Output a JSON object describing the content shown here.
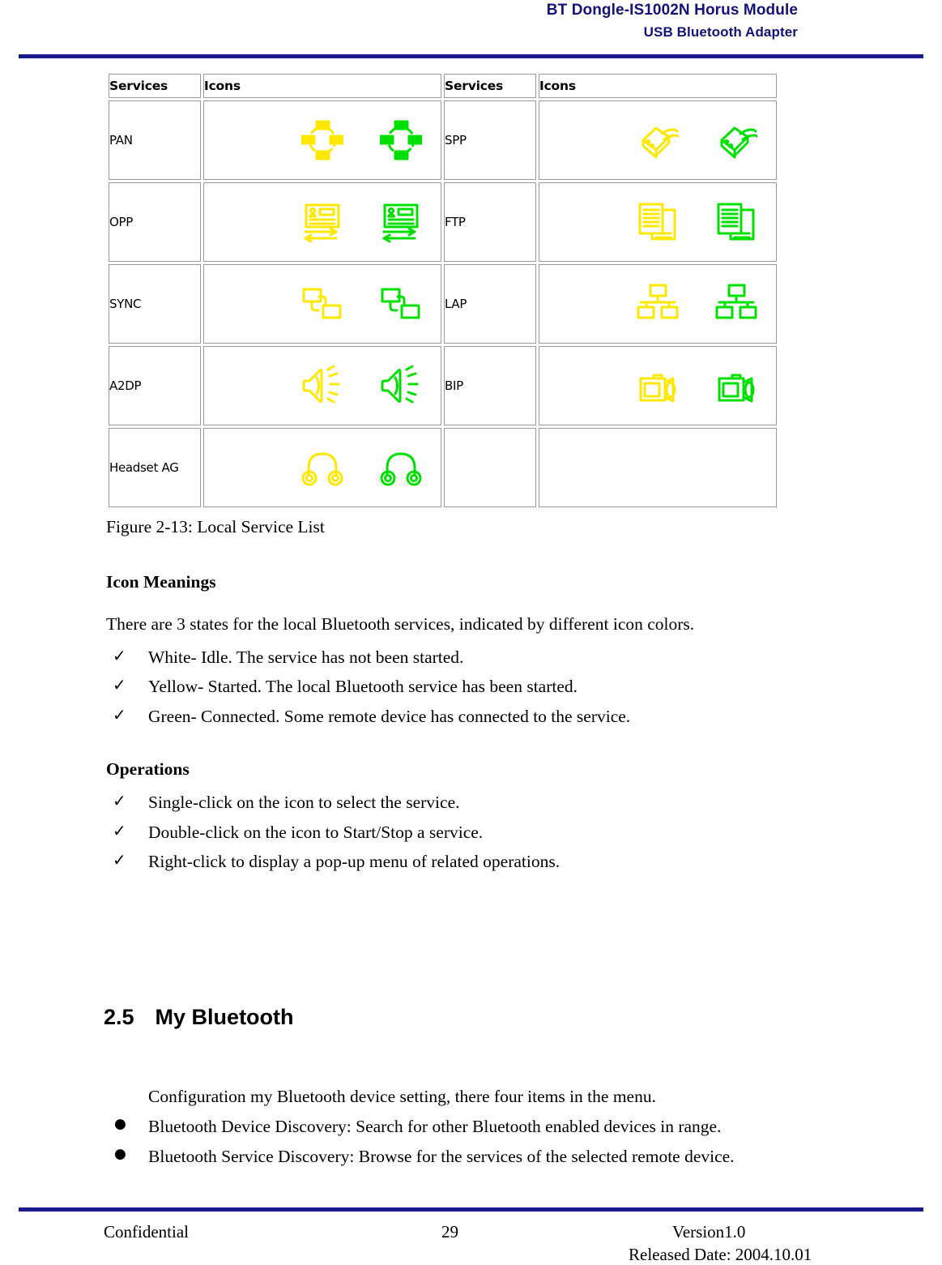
{
  "header": {
    "line1": "BT Dongle-IS1002N Horus Module",
    "line2": "USB Bluetooth Adapter",
    "rule_color": "#1a1a8c"
  },
  "figure": {
    "caption": "Figure 2-13: Local Service List",
    "icon_cell_bg": "#0c7ef5",
    "state_colors": {
      "idle": "#ffffff",
      "started": "#ffe800",
      "connected": "#00e000"
    },
    "columns": [
      {
        "services_header": "Services",
        "icons_header": "Icons"
      },
      {
        "services_header": "Services",
        "icons_header": "Icons"
      }
    ],
    "rows": [
      {
        "left": {
          "service": "PAN",
          "icon": "pan-icon",
          "states": [
            "idle",
            "started",
            "connected"
          ]
        },
        "right": {
          "service": "SPP",
          "icon": "spp-icon",
          "states": [
            "idle",
            "started",
            "connected"
          ]
        }
      },
      {
        "left": {
          "service": "OPP",
          "icon": "opp-icon",
          "states": [
            "idle",
            "started",
            "connected"
          ]
        },
        "right": {
          "service": "FTP",
          "icon": "ftp-icon",
          "states": [
            "idle",
            "started",
            "connected"
          ]
        }
      },
      {
        "left": {
          "service": "SYNC",
          "icon": "sync-icon",
          "states": [
            "idle",
            "started",
            "connected"
          ]
        },
        "right": {
          "service": "LAP",
          "icon": "lap-icon",
          "states": [
            "idle",
            "started",
            "connected"
          ]
        }
      },
      {
        "left": {
          "service": "A2DP",
          "icon": "a2dp-icon",
          "states": [
            "idle",
            "started",
            "connected"
          ]
        },
        "right": {
          "service": "BIP",
          "icon": "bip-icon",
          "states": [
            "idle",
            "started",
            "connected"
          ]
        }
      },
      {
        "left": {
          "service": "Headset AG",
          "icon": "headset-icon",
          "states": [
            "idle",
            "started",
            "connected"
          ]
        },
        "right": {
          "service": "",
          "icon": "",
          "states": []
        }
      }
    ]
  },
  "icon_meanings": {
    "heading": "Icon Meanings",
    "intro": "There are 3 states for the local Bluetooth services, indicated by different icon colors.",
    "items": [
      "White- Idle. The service has not been started.",
      "Yellow- Started. The local Bluetooth service has been started.",
      "Green- Connected. Some remote device has connected to the service."
    ],
    "bullet_glyph": "✓"
  },
  "operations": {
    "heading": "Operations",
    "items": [
      "Single-click on the icon to select the service.",
      "Double-click on the icon to Start/Stop a service.",
      "Right-click to display a pop-up menu of related operations."
    ],
    "bullet_glyph": "✓"
  },
  "section": {
    "number": "2.5",
    "title": "My Bluetooth",
    "intro": "Configuration my Bluetooth device setting, there four items in the menu.",
    "bullet_glyph": "●",
    "items": [
      "Bluetooth Device Discovery: Search for other Bluetooth enabled devices in range.",
      "Bluetooth Service Discovery: Browse for the services of the selected remote device."
    ]
  },
  "footer": {
    "confidential": "Confidential",
    "page_number": "29",
    "version": "Version1.0",
    "released_date": "Released Date: 2004.10.01"
  }
}
